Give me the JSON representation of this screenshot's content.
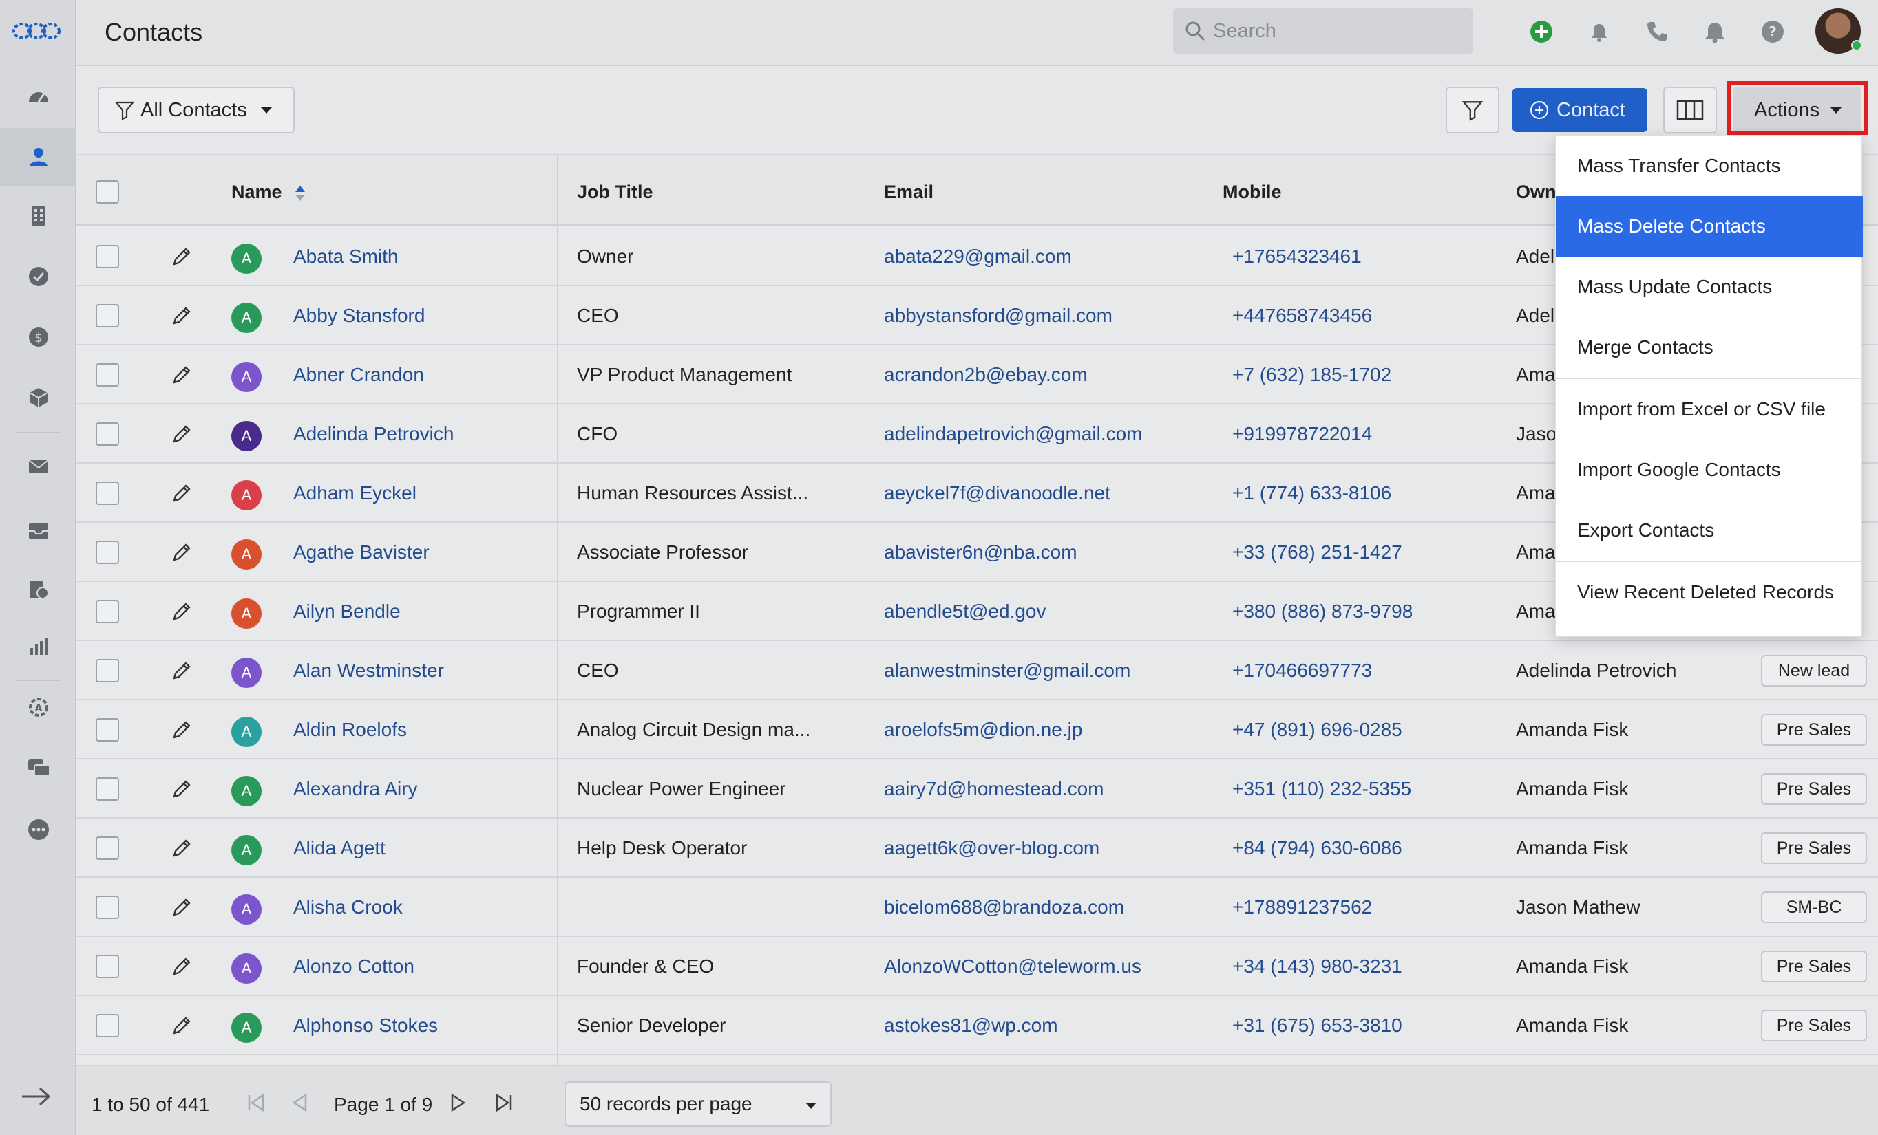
{
  "header": {
    "title": "Contacts",
    "search_placeholder": "Search"
  },
  "toolbar": {
    "view_label": "All Contacts",
    "add_contact_label": "Contact",
    "actions_label": "Actions"
  },
  "table": {
    "columns": {
      "name": "Name",
      "job_title": "Job Title",
      "email": "Email",
      "mobile": "Mobile",
      "owner": "Own"
    },
    "rows": [
      {
        "initial": "A",
        "color": "#2a9a5a",
        "name": "Abata Smith",
        "job": "Owner",
        "email": "abata229@gmail.com",
        "mobile": "+17654323461",
        "owner": "Adel",
        "tag": ""
      },
      {
        "initial": "A",
        "color": "#2a9a5a",
        "name": "Abby Stansford",
        "job": "CEO",
        "email": "abbystansford@gmail.com",
        "mobile": "+447658743456",
        "owner": "Adel",
        "tag": ""
      },
      {
        "initial": "A",
        "color": "#7a55cc",
        "name": "Abner Crandon",
        "job": "VP Product Management",
        "email": "acrandon2b@ebay.com",
        "mobile": "+7 (632) 185-1702",
        "owner": "Ama",
        "tag": ""
      },
      {
        "initial": "A",
        "color": "#4a2a8a",
        "name": "Adelinda Petrovich",
        "job": "CFO",
        "email": "adelindapetrovich@gmail.com",
        "mobile": "+919978722014",
        "owner": "Jaso",
        "tag": ""
      },
      {
        "initial": "A",
        "color": "#d9404a",
        "name": "Adham Eyckel",
        "job": "Human Resources Assist...",
        "email": "aeyckel7f@divanoodle.net",
        "mobile": "+1 (774) 633-8106",
        "owner": "Ama",
        "tag": ""
      },
      {
        "initial": "A",
        "color": "#d9502e",
        "name": "Agathe Bavister",
        "job": "Associate Professor",
        "email": "abavister6n@nba.com",
        "mobile": "+33 (768) 251-1427",
        "owner": "Ama",
        "tag": ""
      },
      {
        "initial": "A",
        "color": "#d9502e",
        "name": "Ailyn Bendle",
        "job": "Programmer II",
        "email": "abendle5t@ed.gov",
        "mobile": "+380 (886) 873-9798",
        "owner": "Ama",
        "tag": ""
      },
      {
        "initial": "A",
        "color": "#7a55cc",
        "name": "Alan Westminster",
        "job": "CEO",
        "email": "alanwestminster@gmail.com",
        "mobile": "+170466697773",
        "owner": "Adelinda Petrovich",
        "tag": "New lead"
      },
      {
        "initial": "A",
        "color": "#2aa0a0",
        "name": "Aldin Roelofs",
        "job": "Analog Circuit Design ma...",
        "email": "aroelofs5m@dion.ne.jp",
        "mobile": "+47 (891) 696-0285",
        "owner": "Amanda Fisk",
        "tag": "Pre Sales"
      },
      {
        "initial": "A",
        "color": "#2a9a5a",
        "name": "Alexandra Airy",
        "job": "Nuclear Power Engineer",
        "email": "aairy7d@homestead.com",
        "mobile": "+351 (110) 232-5355",
        "owner": "Amanda Fisk",
        "tag": "Pre Sales"
      },
      {
        "initial": "A",
        "color": "#2a9a5a",
        "name": "Alida Agett",
        "job": "Help Desk Operator",
        "email": "aagett6k@over-blog.com",
        "mobile": "+84 (794) 630-6086",
        "owner": "Amanda Fisk",
        "tag": "Pre Sales"
      },
      {
        "initial": "A",
        "color": "#7a55cc",
        "name": "Alisha Crook",
        "job": "",
        "email": "bicelom688@brandoza.com",
        "mobile": "+178891237562",
        "owner": "Jason Mathew",
        "tag": "SM-BC"
      },
      {
        "initial": "A",
        "color": "#7a55cc",
        "name": "Alonzo Cotton",
        "job": "Founder & CEO",
        "email": "AlonzoWCotton@teleworm.us",
        "mobile": "+34 (143) 980-3231",
        "owner": "Amanda Fisk",
        "tag": "Pre Sales"
      },
      {
        "initial": "A",
        "color": "#2a9a5a",
        "name": "Alphonso Stokes",
        "job": "Senior Developer",
        "email": "astokes81@wp.com",
        "mobile": "+31 (675) 653-3810",
        "owner": "Amanda Fisk",
        "tag": "Pre Sales"
      }
    ]
  },
  "footer": {
    "range": "1 to 50 of 441",
    "page": "Page 1 of 9",
    "per_page": "50 records per page"
  },
  "actions_menu": {
    "items": [
      {
        "label": "Mass Transfer Contacts"
      },
      {
        "label": "Mass Delete Contacts",
        "selected": true
      },
      {
        "label": "Mass Update Contacts"
      },
      {
        "label": "Merge Contacts"
      },
      {
        "label": "Import from Excel or CSV file"
      },
      {
        "label": "Import Google Contacts"
      },
      {
        "label": "Export Contacts"
      },
      {
        "label": "View Recent Deleted Records"
      }
    ]
  },
  "colors": {
    "accent": "#1f5fc7",
    "menu_selected": "#2b6ae6",
    "highlight": "#e02020"
  }
}
